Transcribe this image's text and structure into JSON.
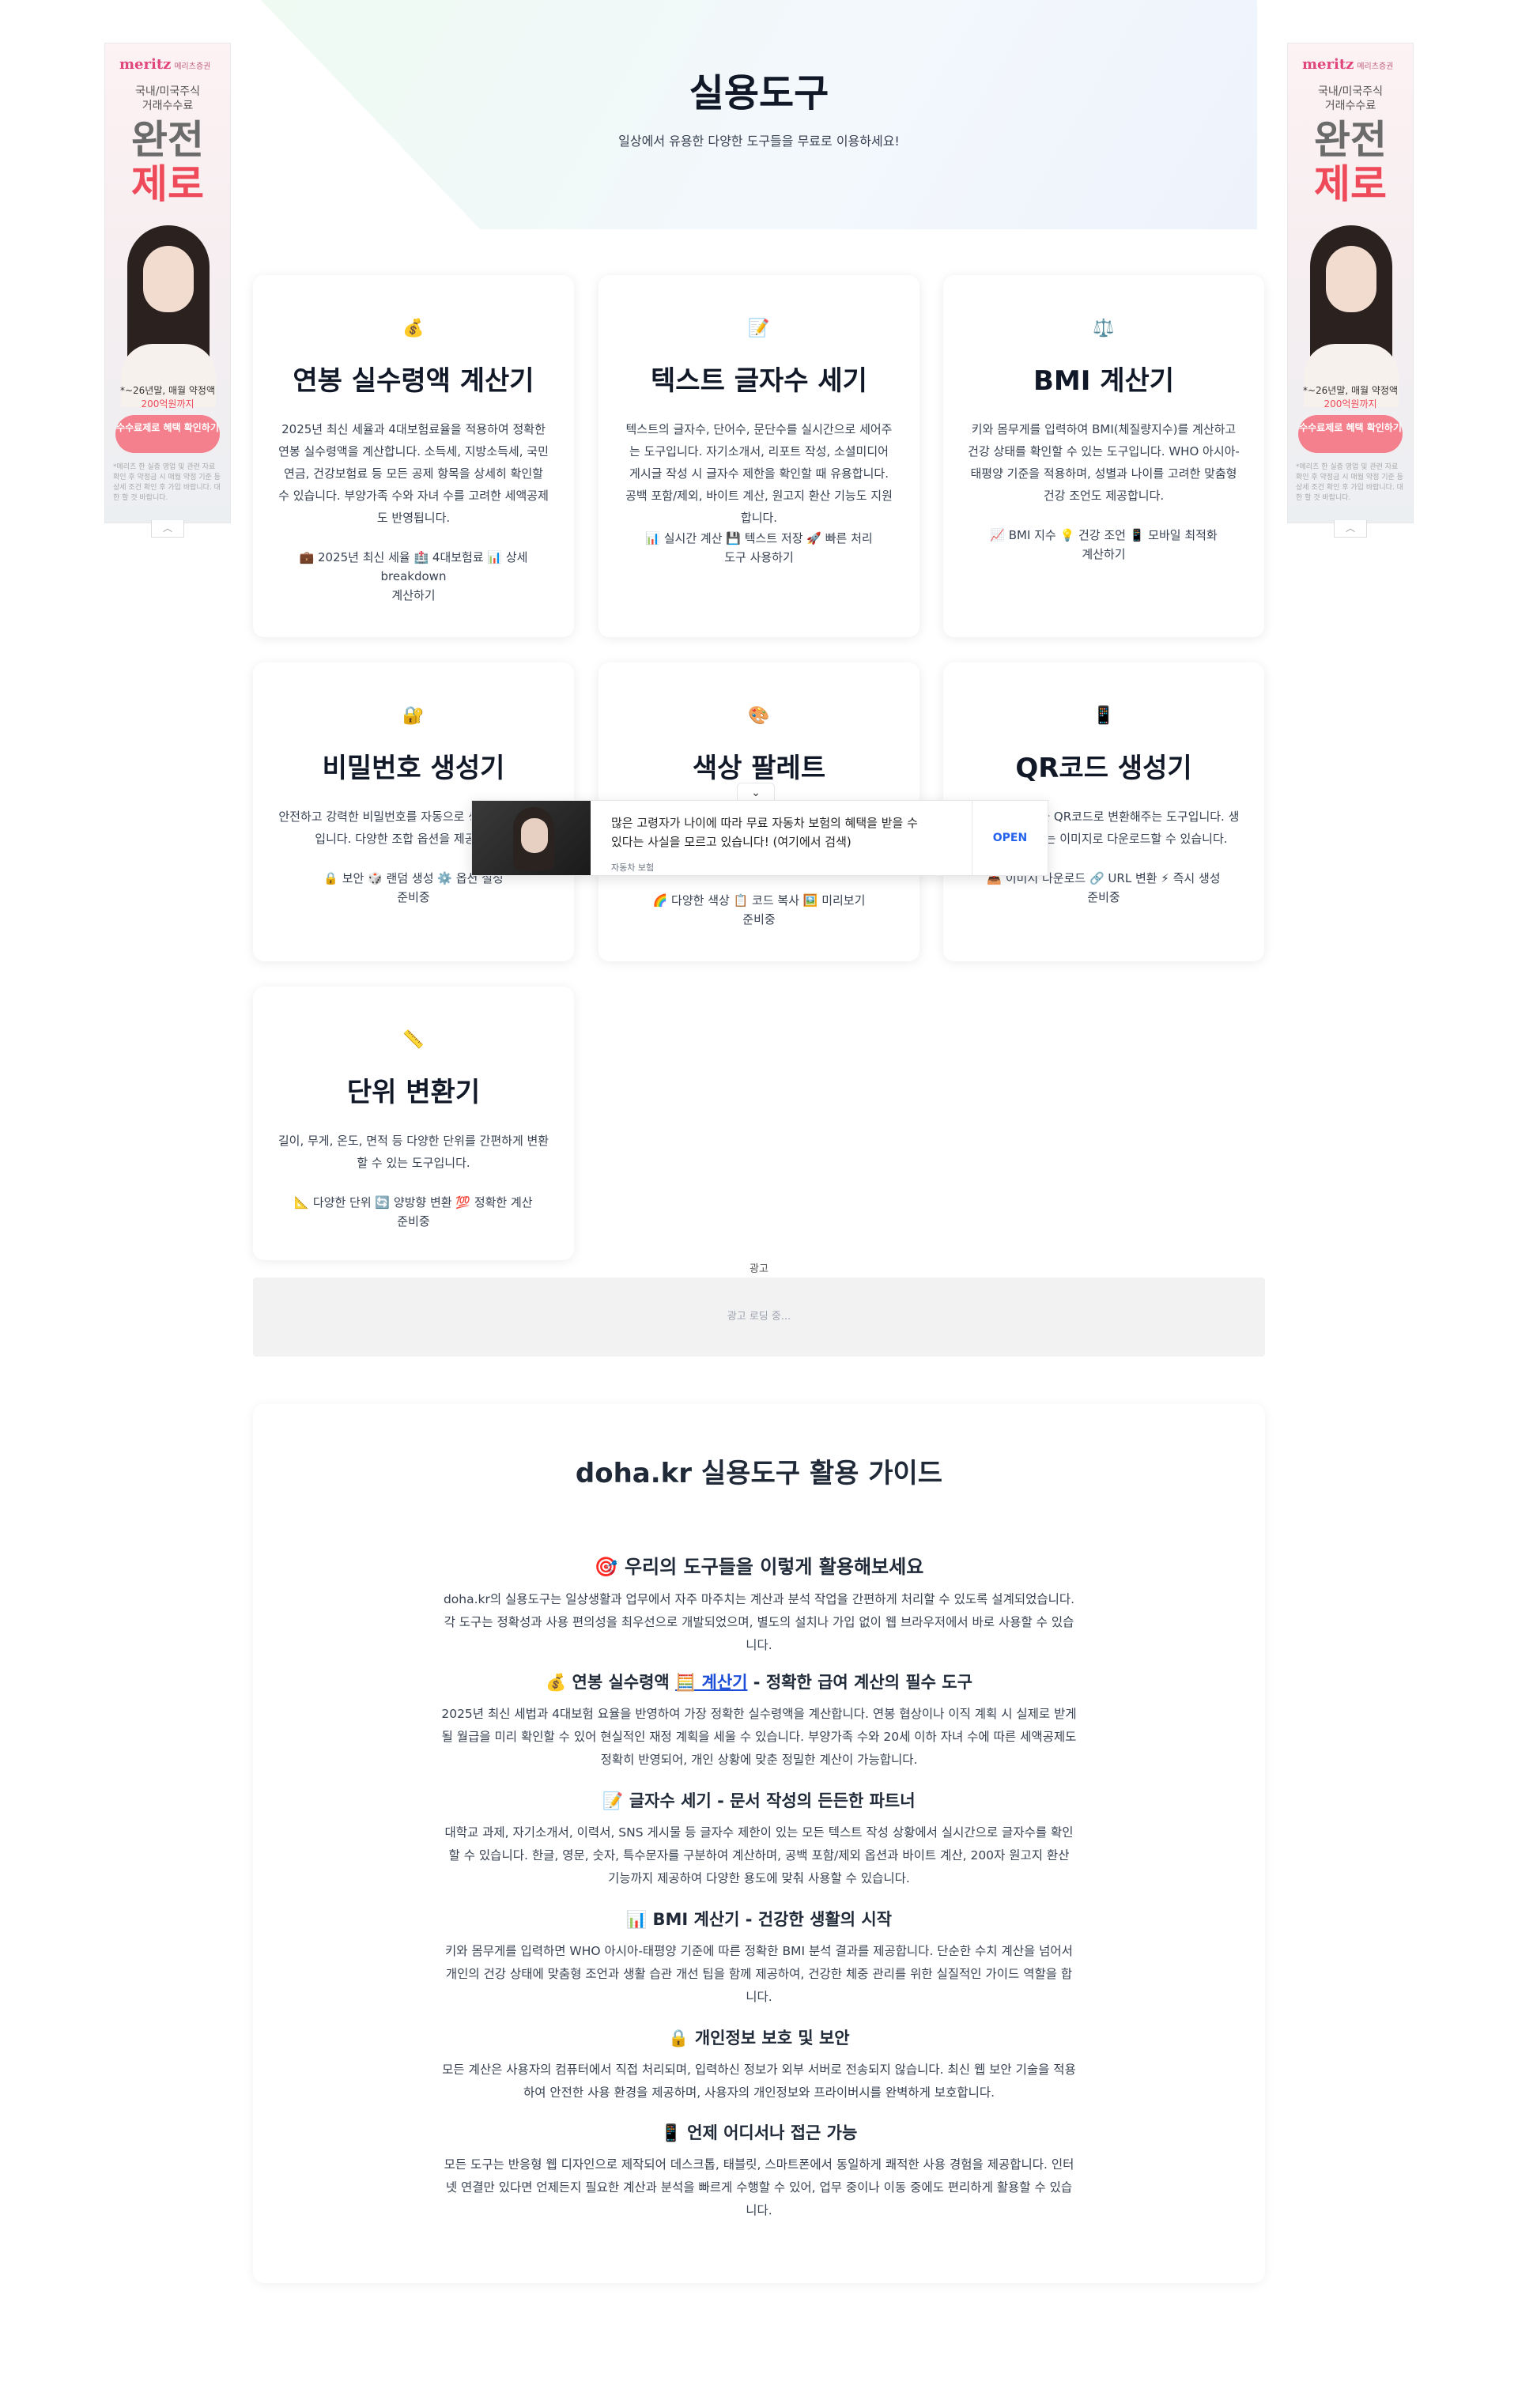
{
  "hero": {
    "title": "실용도구",
    "subtitle": "일상에서 유용한 다양한 도구들을 무료로 이용하세요!"
  },
  "side_ad": {
    "brand": "meritz",
    "brand_sub": "메리츠증권",
    "line1": "국내/미국주식",
    "line2": "거래수수료",
    "big1": "완전",
    "big2": "제로",
    "note_prefix": "*~26년말, 매월 약정액",
    "note_amount": "200억원까지",
    "cta": "수수료제로 혜택 확인하기",
    "fine": "*메리츠 한 실증 영업 및 관련 자료 확인 후 약정금 시 매월 약정 기준 등 상세 조건 확인 후 가입 바랍니다. 대한 할 것 바랍니다.",
    "toggle_icon": "chevron-up-icon"
  },
  "cards": [
    {
      "icon": "💰",
      "icon_name": "money-bag-icon",
      "title": "연봉 실수령액 계산기",
      "desc": "2025년 최신 세율과 4대보험료율을 적용하여 정확한 연봉 실수령액을 계산합니다. 소득세, 지방소득세, 국민연금, 건강보험료 등 모든 공제 항목을 상세히 확인할 수 있습니다. 부양가족 수와 자녀 수를 고려한 세액공제도 반영됩니다.",
      "tags": "💼 2025년 최신 세율 🏥 4대보험료 📊 상세 breakdown",
      "status": "계산하기"
    },
    {
      "icon": "📝",
      "icon_name": "memo-icon",
      "title": "텍스트 글자수 세기",
      "desc": "텍스트의 글자수, 단어수, 문단수를 실시간으로 세어주는 도구입니다. 자기소개서, 리포트 작성, 소셜미디어 게시글 작성 시 글자수 제한을 확인할 때 유용합니다. 공백 포함/제외, 바이트 계산, 원고지 환산 기능도 지원합니다.",
      "tags": "📊 실시간 계산 💾 텍스트 저장 🚀 빠른 처리",
      "status": "도구 사용하기"
    },
    {
      "icon": "⚖️",
      "icon_name": "scale-icon",
      "title": "BMI 계산기",
      "desc": "키와 몸무게를 입력하여 BMI(체질량지수)를 계산하고 건강 상태를 확인할 수 있는 도구입니다. WHO 아시아-태평양 기준을 적용하며, 성별과 나이를 고려한 맞춤형 건강 조언도 제공합니다.",
      "tags": "📈 BMI 지수 💡 건강 조언 📱 모바일 최적화",
      "status": "계산하기"
    },
    {
      "icon": "🔐",
      "icon_name": "lock-key-icon",
      "title": "비밀번호 생성기",
      "desc": "안전하고 강력한 비밀번호를 자동으로 생성해주는 도구입니다. 다양한 조합 옵션을 제공합니다.",
      "tags": "🔒 보안 🎲 랜덤 생성 ⚙️ 옵션 설정",
      "status": "준비중"
    },
    {
      "icon": "🎨",
      "icon_name": "palette-icon",
      "title": "색상 팔레트",
      "desc": "",
      "tags": "🌈 다양한 색상 📋 코드 복사 🖼️ 미리보기",
      "status": "준비중"
    },
    {
      "icon": "📱",
      "icon_name": "mobile-icon",
      "title": "QR코드 생성기",
      "desc": "텍스트나 URL을 QR코드로 변환해주는 도구입니다. 생성된 QR코드는 이미지로 다운로드할 수 있습니다.",
      "tags": "📥 이미지 다운로드 🔗 URL 변환 ⚡ 즉시 생성",
      "status": "준비중"
    },
    {
      "icon": "📏",
      "icon_name": "ruler-icon",
      "title": "단위 변환기",
      "desc": "길이, 무게, 온도, 면적 등 다양한 단위를 간편하게 변환할 수 있는 도구입니다.",
      "tags": "📐 다양한 단위 🔄 양방향 변환 💯 정확한 계산",
      "status": "준비중"
    }
  ],
  "overlay_ad": {
    "text": "많은 고령자가 나이에 따라 무료 자동차 보험의 혜택을 받을 수 있다는 사실을 모르고 있습니다! (여기에서 검색)",
    "source": "자동차 보험",
    "open": "OPEN",
    "collapse_icon": "chevron-down-icon"
  },
  "ad_block": {
    "label": "광고",
    "loading": "광고 로딩 중..."
  },
  "guide": {
    "title": "doha.kr 실용도구 활용 가이드",
    "sections": [
      {
        "heading": "🎯 우리의 도구들을 이렇게 활용해보세요",
        "body": "doha.kr의 실용도구는 일상생활과 업무에서 자주 마주치는 계산과 분석 작업을 간편하게 처리할 수 있도록 설계되었습니다. 각 도구는 정확성과 사용 편의성을 최우선으로 개발되었으며, 별도의 설치나 가입 없이 웹 브라우저에서 바로 사용할 수 있습니다."
      },
      {
        "heading_pre": "💰 연봉 실수령액 ",
        "link": "🧮 계산기",
        "heading_post": " - 정확한 급여 계산의 필수 도구",
        "body": "2025년 최신 세법과 4대보험 요율을 반영하여 가장 정확한 실수령액을 계산합니다. 연봉 협상이나 이직 계획 시 실제로 받게 될 월급을 미리 확인할 수 있어 현실적인 재정 계획을 세울 수 있습니다. 부양가족 수와 20세 이하 자녀 수에 따른 세액공제도 정확히 반영되어, 개인 상황에 맞춘 정밀한 계산이 가능합니다."
      },
      {
        "heading": "📝 글자수 세기 - 문서 작성의 든든한 파트너",
        "body": "대학교 과제, 자기소개서, 이력서, SNS 게시물 등 글자수 제한이 있는 모든 텍스트 작성 상황에서 실시간으로 글자수를 확인할 수 있습니다. 한글, 영문, 숫자, 특수문자를 구분하여 계산하며, 공백 포함/제외 옵션과 바이트 계산, 200자 원고지 환산 기능까지 제공하여 다양한 용도에 맞춰 사용할 수 있습니다."
      },
      {
        "heading": "📊 BMI 계산기 - 건강한 생활의 시작",
        "body": "키와 몸무게를 입력하면 WHO 아시아-태평양 기준에 따른 정확한 BMI 분석 결과를 제공합니다. 단순한 수치 계산을 넘어서 개인의 건강 상태에 맞춤형 조언과 생활 습관 개선 팁을 함께 제공하여, 건강한 체중 관리를 위한 실질적인 가이드 역할을 합니다."
      },
      {
        "heading": "🔒 개인정보 보호 및 보안",
        "body": "모든 계산은 사용자의 컴퓨터에서 직접 처리되며, 입력하신 정보가 외부 서버로 전송되지 않습니다. 최신 웹 보안 기술을 적용하여 안전한 사용 환경을 제공하며, 사용자의 개인정보와 프라이버시를 완벽하게 보호합니다."
      },
      {
        "heading": "📱 언제 어디서나 접근 가능",
        "body": "모든 도구는 반응형 웹 디자인으로 제작되어 데스크톱, 태블릿, 스마트폰에서 동일하게 쾌적한 사용 경험을 제공합니다. 인터넷 연결만 있다면 언제든지 필요한 계산과 분석을 빠르게 수행할 수 있어, 업무 중이나 이동 중에도 편리하게 활용할 수 있습니다."
      }
    ]
  }
}
